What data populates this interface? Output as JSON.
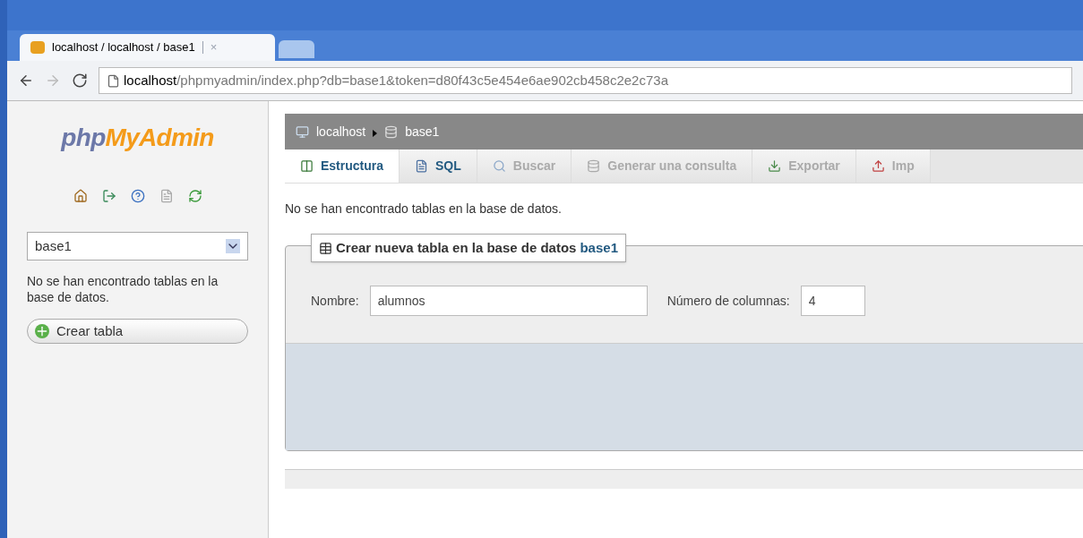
{
  "browser": {
    "tab_title": "localhost / localhost / base1",
    "tab_close": "×",
    "url_host": "localhost",
    "url_path": "/phpmyadmin/index.php?db=base1&token=d80f43c5e454e6ae902cb458c2e2c73a"
  },
  "sidebar": {
    "logo_php": "php",
    "logo_rest": "MyAdmin",
    "db_select": "base1",
    "message": "No se han encontrado tablas en la base de datos.",
    "create_button": "Crear tabla"
  },
  "breadcrumb": [
    {
      "label": "localhost",
      "kind": "server"
    },
    {
      "label": "base1",
      "kind": "database"
    }
  ],
  "tabs": [
    {
      "label": "Estructura",
      "kind": "structure",
      "selected": true,
      "disabled": false
    },
    {
      "label": "SQL",
      "kind": "sql",
      "selected": false,
      "disabled": false
    },
    {
      "label": "Buscar",
      "kind": "search",
      "selected": false,
      "disabled": true
    },
    {
      "label": "Generar una consulta",
      "kind": "query",
      "selected": false,
      "disabled": true
    },
    {
      "label": "Exportar",
      "kind": "export",
      "selected": false,
      "disabled": true
    },
    {
      "label": "Imp",
      "kind": "import",
      "selected": false,
      "disabled": true
    }
  ],
  "notice": "No se han encontrado tablas en la base de datos.",
  "create_table": {
    "legend": "Crear nueva tabla en la base de datos",
    "legend_db": "base1",
    "name_label": "Nombre:",
    "name_value": "alumnos",
    "columns_label": "Número de columnas:",
    "columns_value": "4"
  }
}
